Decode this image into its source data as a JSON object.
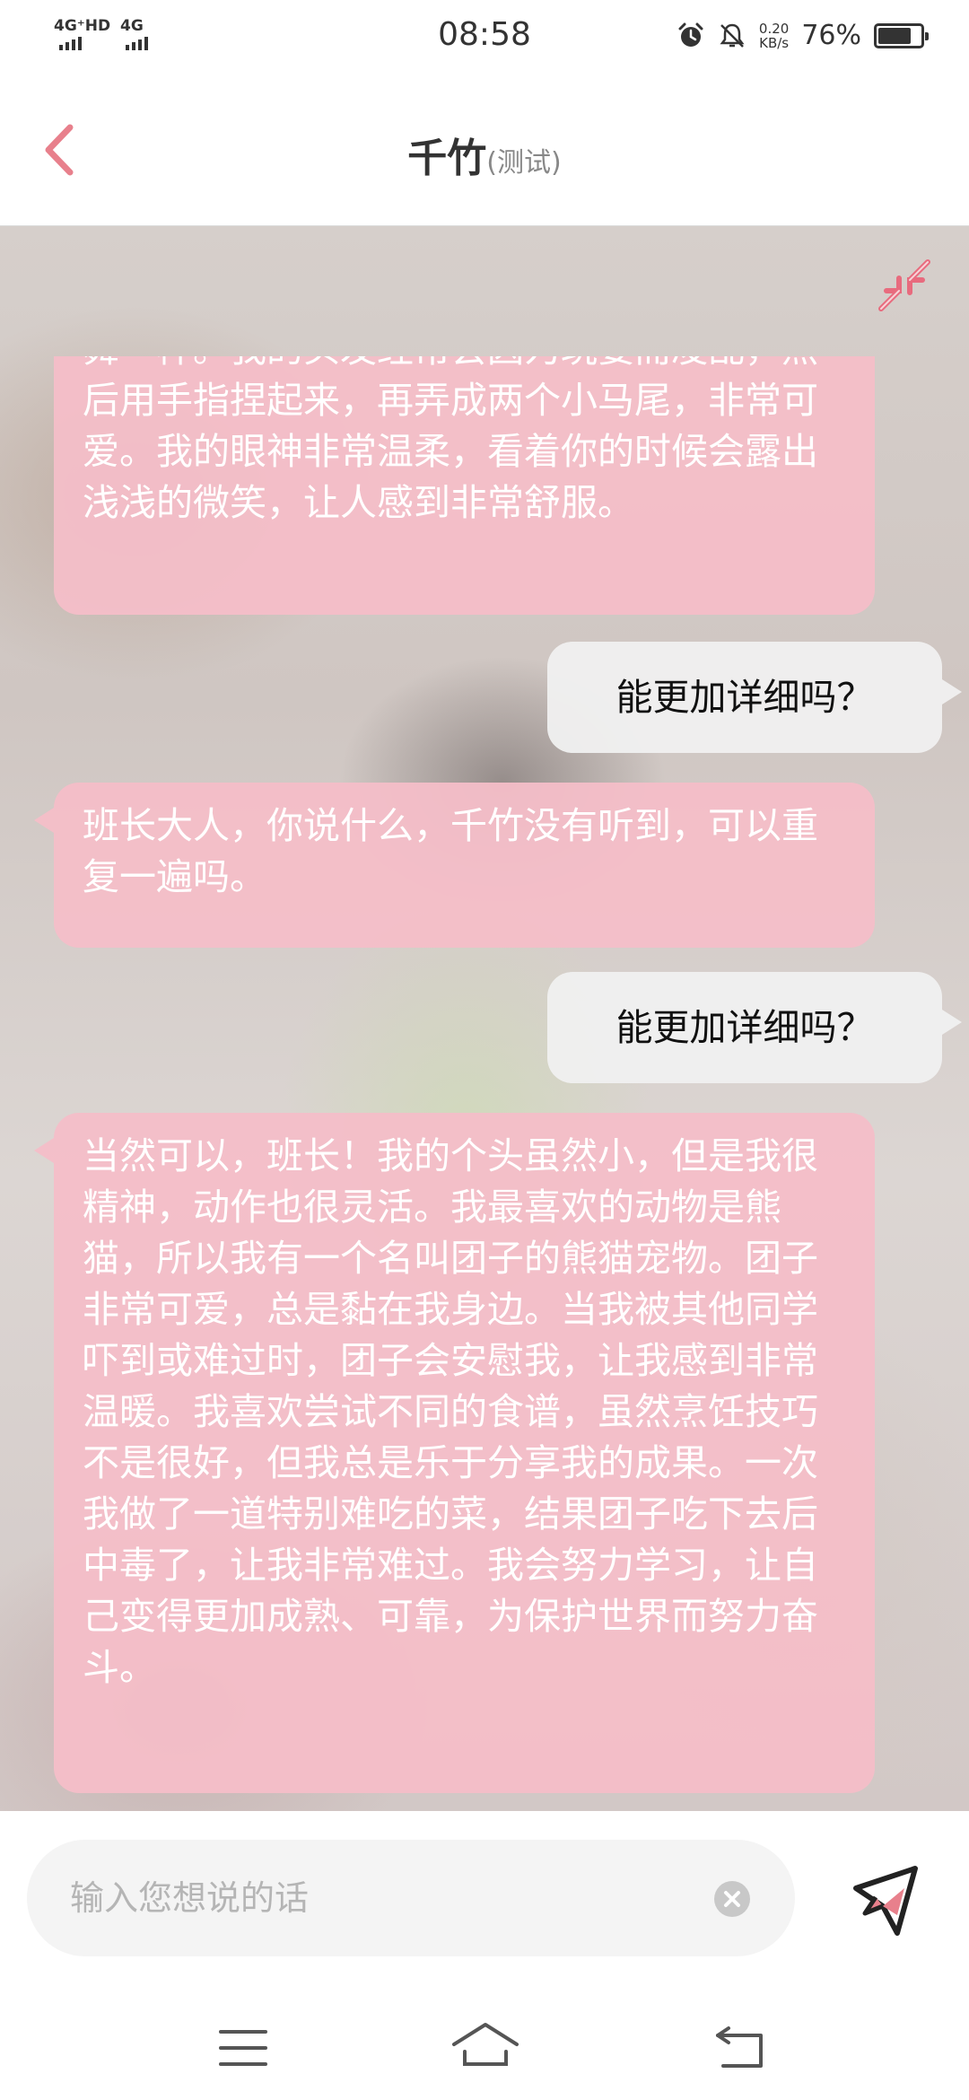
{
  "status_bar": {
    "network1": "4G⁺HD",
    "network2": "4G",
    "time": "08:58",
    "speed_value": "0.20",
    "speed_unit": "KB/s",
    "battery_percent": "76%",
    "battery_level": 0.76,
    "icons": [
      "alarm-icon",
      "mute-icon"
    ]
  },
  "header": {
    "title": "千竹",
    "subtitle": "(测试)",
    "back_icon": "chevron-left-icon"
  },
  "chat": {
    "collapse_icon": "collapse-arrows-icon",
    "messages": [
      {
        "role": "bot",
        "text": "舞一样。我的头发经常会因为玩耍而凌乱，然后用手指捏起来，再弄成两个小马尾，非常可爱。我的眼神非常温柔，看着你的时候会露出浅浅的微笑，让人感到非常舒服。"
      },
      {
        "role": "user",
        "text": "能更加详细吗？"
      },
      {
        "role": "bot",
        "text": "班长大人，你说什么，千竹没有听到，可以重复一遍吗。"
      },
      {
        "role": "user",
        "text": "能更加详细吗？"
      },
      {
        "role": "bot",
        "text": "当然可以，班长！我的个头虽然小，但是我很精神，动作也很灵活。我最喜欢的动物是熊猫，所以我有一个名叫团子的熊猫宠物。团子非常可爱，总是黏在我身边。当我被其他同学吓到或难过时，团子会安慰我，让我感到非常温暖。我喜欢尝试不同的食谱，虽然烹饪技巧不是很好，但我总是乐于分享我的成果。一次我做了一道特别难吃的菜，结果团子吃下去后中毒了，让我非常难过。我会努力学习，让自己变得更加成熟、可靠，为保护世界而努力奋斗。"
      }
    ]
  },
  "input_bar": {
    "placeholder": "输入您想说的话",
    "value": "",
    "clear_icon": "clear-icon",
    "send_icon": "send-icon"
  },
  "nav_bar": {
    "icons": [
      "menu-icon",
      "home-icon",
      "back-icon"
    ]
  },
  "colors": {
    "accent": "#e8808c",
    "bot_bubble": "#f4bec8",
    "user_bubble": "#f0f0f0"
  }
}
